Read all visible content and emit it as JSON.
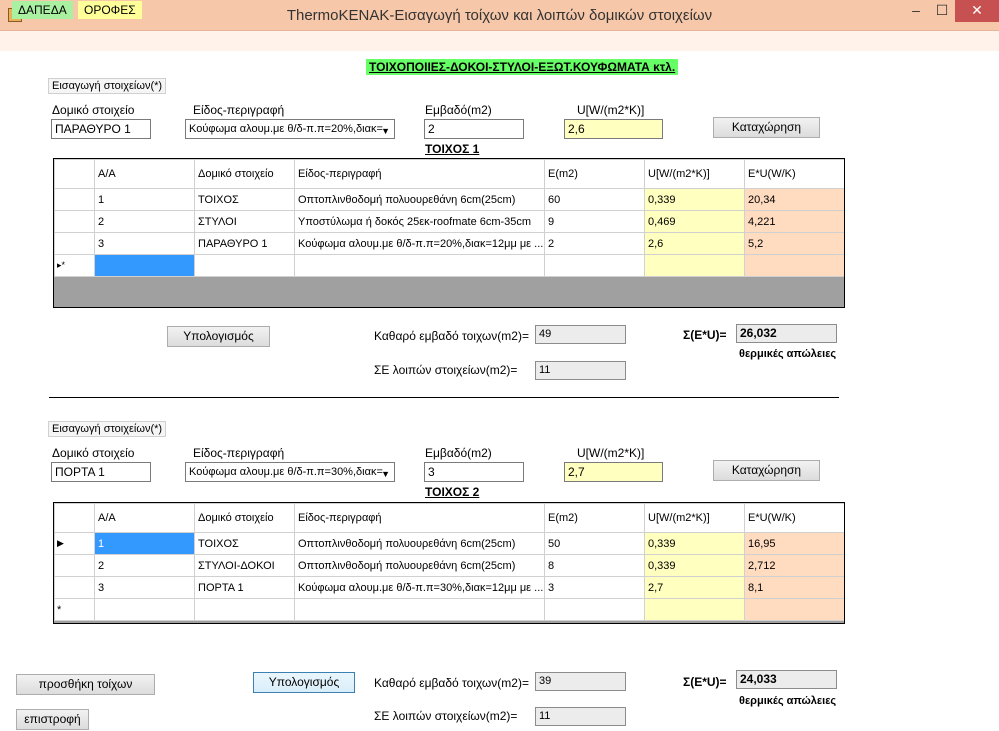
{
  "window": {
    "title": "ThermoKENAK-Εισαγωγή τοίχων και λοιπών δομικών στοιχείων",
    "minimize": "–",
    "maximize": "☐",
    "close": "✕",
    "icon": "app-icon"
  },
  "menu": {
    "items": [
      "ΔΑΠΕΔΑ",
      "ΟΡΟΦΕΣ"
    ]
  },
  "page_heading": "ΤΟΙΧΟΠΟΙΙΕΣ-ΔΟΚΟΙ-ΣΤΥΛΟΙ-ΕΞΩΤ.ΚΟΥΦΩΜΑΤΑ κτλ.",
  "colors": {
    "grid_yellow": "#ffffc0",
    "grid_peach": "#ffdcc0",
    "menu_green": "#a9f0a0",
    "heading_green": "#66ff66"
  },
  "walls": [
    {
      "group_label": "Εισαγωγή στοιχείων(*)",
      "element_label": "Δομικό στοιχείο",
      "element_value": "ΠΑΡΑΘΥΡΟ 1",
      "type_label": "Είδος-περιγραφή",
      "type_value": "Κούφωμα αλουμ.με θ/δ-π.π=20%,διακ=",
      "area_label": "Εμβαδό(m2)",
      "area_value": "2",
      "u_label": "U[W/(m2*K)]",
      "u_value": "2,6",
      "submit_label": "Καταχώρηση",
      "heading": "ΤΟΙΧΟΣ  1",
      "columns": [
        "Α/Α",
        "Δομικό στοιχείο",
        "Είδος-περιγραφή",
        "E(m2)",
        "U[W/(m2*K)]",
        "E*U(W/K)"
      ],
      "rows": [
        {
          "aa": "1",
          "element": "ΤΟΙΧΟΣ",
          "desc": "Οπτοπλινθοδομή πολυουρεθάνη 6cm(25cm)",
          "e": "60",
          "u": "0,339",
          "eu": "20,34"
        },
        {
          "aa": "2",
          "element": "ΣΤΥΛΟΙ",
          "desc": "Υποστύλωμα ή δοκός 25εκ-roofmate 6cm-35cm",
          "e": "9",
          "u": "0,469",
          "eu": "4,221"
        },
        {
          "aa": "3",
          "element": "ΠΑΡΑΘΥΡΟ 1",
          "desc": "Κούφωμα αλουμ.με θ/δ-π.π=20%,διακ=12μμ με ...",
          "e": "2",
          "u": "2,6",
          "eu": "5,2"
        }
      ],
      "new_row_marker": "▸*",
      "calc_label": "Υπολογισμός",
      "net_area_label": "Καθαρό εμβαδό τοιχων(m2)=",
      "net_area_value": "49",
      "other_area_label": "ΣΕ λοιπών στοιχείων(m2)=",
      "other_area_value": "11",
      "sum_label": "Σ(Ε*U)=",
      "sum_value": "26,032",
      "losses_label": "θερμικές απώλειες"
    },
    {
      "group_label": "Εισαγωγή στοιχείων(*)",
      "element_label": "Δομικό στοιχείο",
      "element_value": "ΠΟΡΤΑ 1",
      "type_label": "Είδος-περιγραφή",
      "type_value": "Κούφωμα αλουμ.με θ/δ-π.π=30%,διακ=",
      "area_label": "Εμβαδό(m2)",
      "area_value": "3",
      "u_label": "U[W/(m2*K)]",
      "u_value": "2,7",
      "submit_label": "Καταχώρηση",
      "heading": "ΤΟΙΧΟΣ  2",
      "columns": [
        "Α/Α",
        "Δομικό στοιχείο",
        "Είδος-περιγραφή",
        "E(m2)",
        "U[W/(m2*K)]",
        "E*U(W/K)"
      ],
      "rows": [
        {
          "aa": "1",
          "element": "ΤΟΙΧΟΣ",
          "desc": "Οπτοπλινθοδομή πολυουρεθάνη 6cm(25cm)",
          "e": "50",
          "u": "0,339",
          "eu": "16,95"
        },
        {
          "aa": "2",
          "element": "ΣΤΥΛΟΙ-ΔΟΚΟΙ",
          "desc": "Οπτοπλινθοδομή πολυουρεθάνη 6cm(25cm)",
          "e": "8",
          "u": "0,339",
          "eu": "2,712"
        },
        {
          "aa": "3",
          "element": "ΠΟΡΤΑ 1",
          "desc": "Κούφωμα αλουμ.με θ/δ-π.π=30%,διακ=12μμ με ...",
          "e": "3",
          "u": "2,7",
          "eu": "8,1"
        }
      ],
      "current_row_marker": "▶",
      "new_row_marker": "*",
      "calc_label": "Υπολογισμός",
      "net_area_label": "Καθαρό εμβαδό τοιχων(m2)=",
      "net_area_value": "39",
      "other_area_label": "ΣΕ λοιπών στοιχείων(m2)=",
      "other_area_value": "11",
      "sum_label": "Σ(Ε*U)=",
      "sum_value": "24,033",
      "losses_label": "θερμικές απώλειες"
    }
  ],
  "footer": {
    "add_walls_label": "προσθήκη τοίχων",
    "back_label": "επιστροφή"
  }
}
